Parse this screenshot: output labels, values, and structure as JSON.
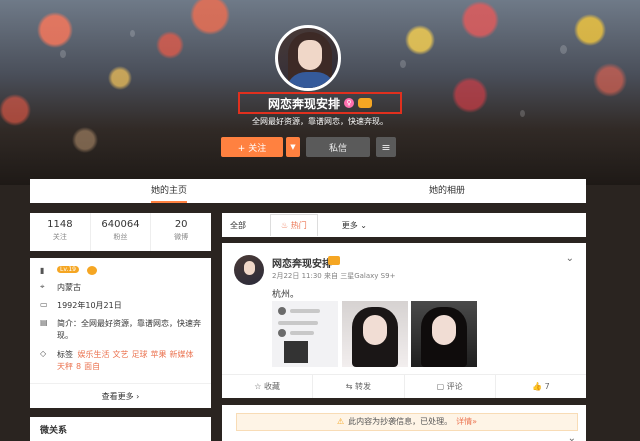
{
  "profile": {
    "name": "网恋奔现安排",
    "bio": "全网最好资源，靠谱网恋，快速奔现。",
    "follow_label": "+ 关注",
    "more_label": "▼",
    "message_label": "私信",
    "menu_label": "≡"
  },
  "tabs": [
    {
      "label": "她的主页",
      "active": true
    },
    {
      "label": "她的相册",
      "active": false
    }
  ],
  "stats": [
    {
      "num": "1148",
      "label": "关注"
    },
    {
      "num": "640064",
      "label": "粉丝"
    },
    {
      "num": "20",
      "label": "微博"
    }
  ],
  "info": {
    "level": "Lv.19",
    "location": "内蒙古",
    "birthday": "1992年10月21日",
    "intro": "简介：全网最好资源，靠谱网恋，快速奔现。",
    "tags_prefix": "标签",
    "tags": [
      "娱乐生活",
      "文艺",
      "足球",
      "苹果",
      "新媒体",
      "天秤",
      "8",
      "面自"
    ],
    "see_all": "查看更多 ›"
  },
  "weiguanxi": {
    "title": "微关系"
  },
  "filter": {
    "all": "全部",
    "hot": "热门",
    "more": "更多 ⌄"
  },
  "post": {
    "author": "网恋奔现安排",
    "meta": "2月22日 11:30 来自 三星Galaxy S9+",
    "text": "杭州。",
    "actions": {
      "favorite": "收藏",
      "repost": "转发",
      "comment": "评论",
      "like": "7"
    }
  },
  "post2": {
    "notice": "此内容为抄袭信息，已处理。",
    "notice_link": "详情»"
  },
  "colors": {
    "accent": "#ff8140",
    "link": "#eb7350",
    "highlight_box": "#e0301e"
  }
}
